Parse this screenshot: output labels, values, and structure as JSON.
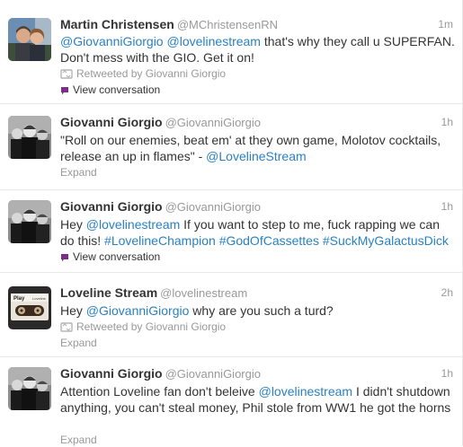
{
  "colors": {
    "link": "#2a81c2",
    "text": "#333333",
    "muted": "#999999",
    "bubble": "#7b2e86"
  },
  "tweets": [
    {
      "fullname": "Martin Christensen",
      "username": "@MChristensenRN",
      "time": "1m",
      "text_parts": [
        {
          "t": "@GiovanniGiorgio",
          "link": true
        },
        {
          "t": " ",
          "link": false
        },
        {
          "t": "@lovelinestream",
          "link": true
        },
        {
          "t": " that's why they call u SUPERFAN. Don't mess with the GIO. Get it on!",
          "link": false
        }
      ],
      "retweeted_by": "Retweeted by Giovanni Giorgio",
      "view_conversation": "View conversation",
      "avatar_icon": "couple-photo-avatar"
    },
    {
      "fullname": "Giovanni Giorgio",
      "username": "@GiovanniGiorgio",
      "time": "1h",
      "text_parts": [
        {
          "t": "\"Roll on our enemies, beat em' at they own game, Molotov cocktails, release an up in flames\" - ",
          "link": false
        },
        {
          "t": "@LovelineStream",
          "link": true
        }
      ],
      "expand": "Expand",
      "avatar_icon": "three-men-photo-avatar"
    },
    {
      "fullname": "Giovanni Giorgio",
      "username": "@GiovanniGiorgio",
      "time": "1h",
      "text_parts": [
        {
          "t": "Hey ",
          "link": false
        },
        {
          "t": "@lovelinestream",
          "link": true
        },
        {
          "t": " If you want to step to me, fuck rapping we can do this! ",
          "link": false
        },
        {
          "t": "#LovelineChampion",
          "link": true
        },
        {
          "t": " ",
          "link": false
        },
        {
          "t": "#GodOfCassettes",
          "link": true
        },
        {
          "t": " ",
          "link": false
        },
        {
          "t": "#SuckMyGalactusDick",
          "link": true
        }
      ],
      "view_conversation": "View conversation",
      "avatar_icon": "three-men-photo-avatar"
    },
    {
      "fullname": "Loveline Stream",
      "username": "@lovelinestream",
      "time": "2h",
      "text_parts": [
        {
          "t": "Hey ",
          "link": false
        },
        {
          "t": "@GiovanniGiorgio",
          "link": true
        },
        {
          "t": " why are you such a turd?",
          "link": false
        }
      ],
      "retweeted_by": "Retweeted by Giovanni Giorgio",
      "expand": "Expand",
      "avatar_icon": "cassette-tape-avatar",
      "avatar_text": [
        "Play",
        "Loveline"
      ]
    },
    {
      "fullname": "Giovanni Giorgio",
      "username": "@GiovanniGiorgio",
      "time": "1h",
      "text_parts": [
        {
          "t": "Attention Loveline fan don't beleive ",
          "link": false
        },
        {
          "t": "@lovelinestream",
          "link": true
        },
        {
          "t": " I didn't shutdown anything, you can't steal money, Phil stole from WW1 he got the horns",
          "link": false
        }
      ],
      "expand": "Expand",
      "avatar_icon": "three-men-photo-avatar"
    }
  ]
}
